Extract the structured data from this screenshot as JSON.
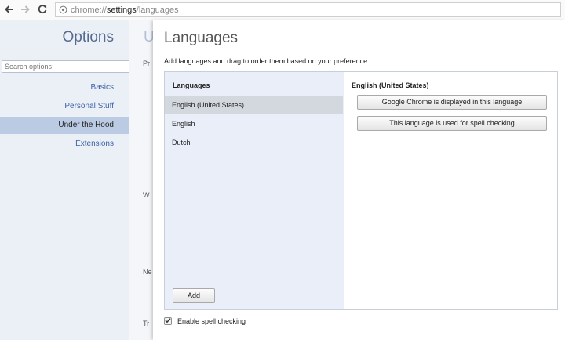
{
  "browser": {
    "url_scheme": "chrome://",
    "url_host": "settings",
    "url_path": "/languages"
  },
  "sidebar": {
    "title": "Options",
    "search_placeholder": "Search options",
    "items": [
      {
        "label": "Basics",
        "selected": false
      },
      {
        "label": "Personal Stuff",
        "selected": false
      },
      {
        "label": "Under the Hood",
        "selected": true
      },
      {
        "label": "Extensions",
        "selected": false
      }
    ]
  },
  "background_page": {
    "title_char": "U",
    "fragments": [
      "Pr",
      "W",
      "Ne",
      "Tr"
    ]
  },
  "dialog": {
    "title": "Languages",
    "description": "Add languages and drag to order them based on your preference.",
    "list_header": "Languages",
    "languages": [
      {
        "label": "English (United States)",
        "selected": true
      },
      {
        "label": "English",
        "selected": false
      },
      {
        "label": "Dutch",
        "selected": false
      }
    ],
    "add_button": "Add",
    "detail_title": "English (United States)",
    "display_language_button": "Google Chrome is displayed in this language",
    "spell_check_language_button": "This language is used for spell checking",
    "spell_check_label": "Enable spell checking",
    "spell_check_enabled": true
  },
  "colors": {
    "sidebar_bg": "#ebeff6",
    "sidebar_selected": "#bccbe4",
    "link_blue": "#3d62a8",
    "list_bg": "#e9eef8"
  }
}
